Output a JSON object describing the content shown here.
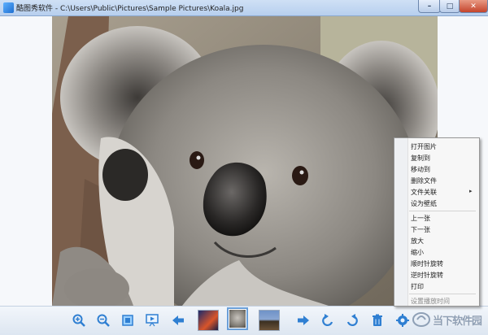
{
  "window": {
    "title": "酷图秀软件 - C:\\Users\\Public\\Pictures\\Sample Pictures\\Koala.jpg",
    "min_glyph": "–",
    "max_glyph": "□",
    "close_glyph": "✕"
  },
  "toolbar": {
    "buttons": [
      "zoom-in-icon",
      "zoom-out-icon",
      "fit-window-icon",
      "slideshow-icon",
      "prev-arrow-icon",
      "next-arrow-icon",
      "rotate-left-icon",
      "rotate-right-icon",
      "delete-icon",
      "settings-icon"
    ],
    "thumbnails": [
      "thumbnail-jellyfish",
      "thumbnail-koala",
      "thumbnail-lighthouse"
    ],
    "selected_thumbnail": "thumbnail-koala"
  },
  "context_menu": {
    "group1": [
      "打开图片",
      "复制到",
      "移动到",
      "删除文件",
      "文件关联",
      "设为壁纸"
    ],
    "group2": [
      "上一张",
      "下一张",
      "放大",
      "缩小",
      "顺时针旋转",
      "逆时针旋转",
      "打印"
    ],
    "group3": [
      "设置播放时间"
    ],
    "submenu_arrow": "▸"
  },
  "watermark": {
    "text": "当下软件园"
  },
  "colors": {
    "title_bar": "#c4d8f1",
    "close_button": "#c4442b",
    "toolbar_icon": "#2f7fd2"
  }
}
